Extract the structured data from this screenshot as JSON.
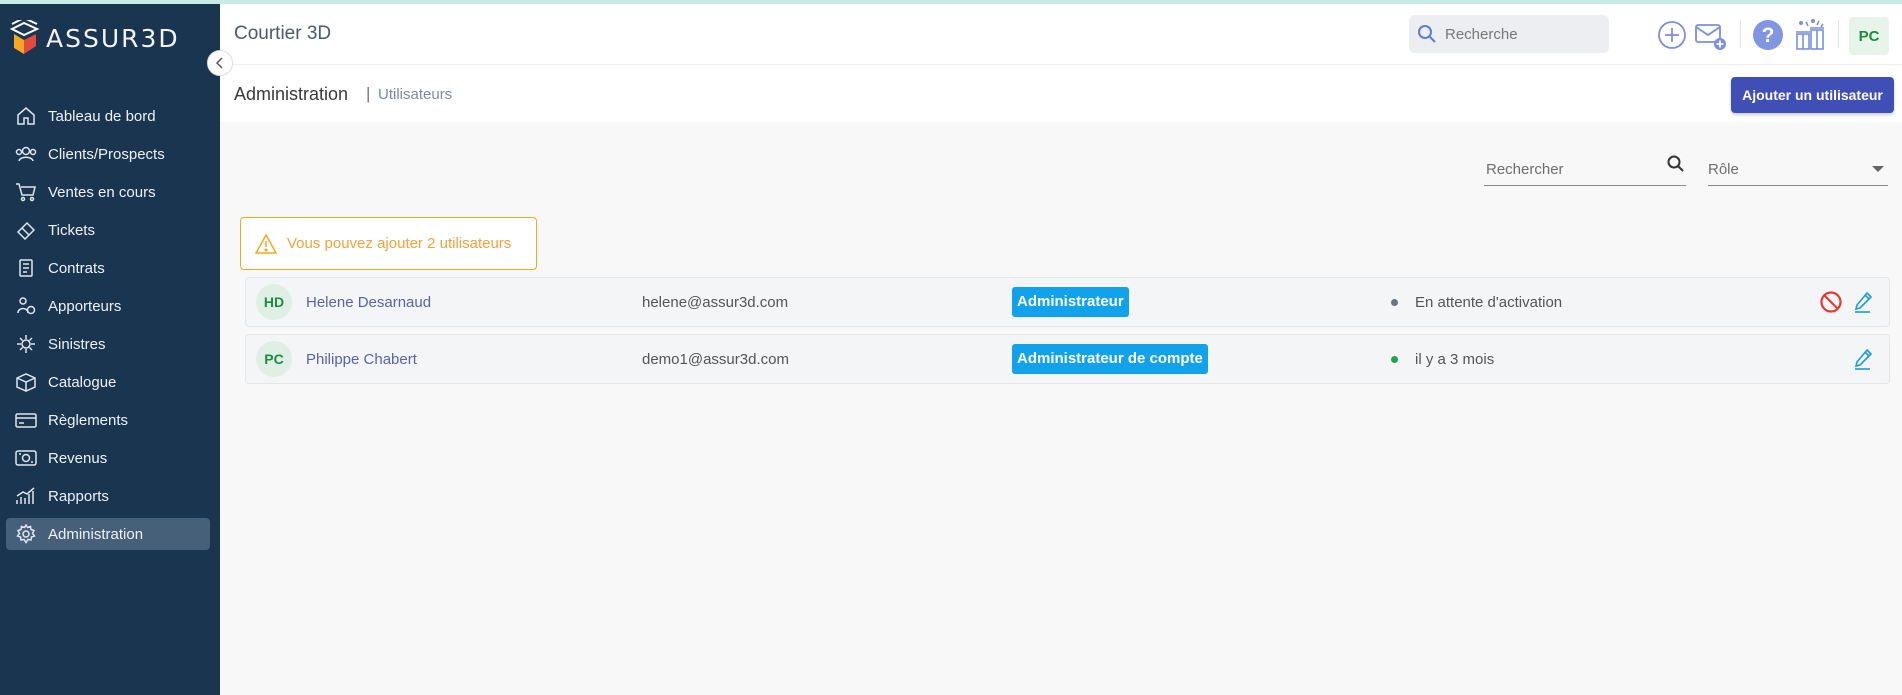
{
  "brand": {
    "logo_text": "ASSUR3D"
  },
  "sidebar": {
    "items": [
      {
        "label": "Tableau de bord",
        "icon": "home-icon"
      },
      {
        "label": "Clients/Prospects",
        "icon": "users-icon"
      },
      {
        "label": "Ventes en cours",
        "icon": "cart-icon"
      },
      {
        "label": "Tickets",
        "icon": "ticket-icon"
      },
      {
        "label": "Contrats",
        "icon": "contract-icon"
      },
      {
        "label": "Apporteurs",
        "icon": "partner-icon"
      },
      {
        "label": "Sinistres",
        "icon": "claims-icon"
      },
      {
        "label": "Catalogue",
        "icon": "catalog-icon"
      },
      {
        "label": "Règlements",
        "icon": "payment-card-icon"
      },
      {
        "label": "Revenus",
        "icon": "revenue-icon"
      },
      {
        "label": "Rapports",
        "icon": "report-chart-icon"
      },
      {
        "label": "Administration",
        "icon": "gear-icon",
        "active": true
      }
    ]
  },
  "topbar": {
    "title": "Courtier 3D",
    "search_placeholder": "Recherche",
    "user_initials": "PC"
  },
  "header": {
    "breadcrumb_main": "Administration",
    "breadcrumb_separator": "|",
    "breadcrumb_sub": "Utilisateurs",
    "add_button": "Ajouter un utilisateur"
  },
  "filters": {
    "search_placeholder": "Rechercher",
    "role_placeholder": "Rôle"
  },
  "warning": {
    "text": "Vous pouvez ajouter 2 utilisateurs"
  },
  "users": [
    {
      "initials": "HD",
      "name": "Helene Desarnaud",
      "email": "helene@assur3d.com",
      "role": "Administrateur",
      "status": "En attente d'activation",
      "status_color": "#6b7480",
      "can_block": true
    },
    {
      "initials": "PC",
      "name": "Philippe Chabert",
      "email": "demo1@assur3d.com",
      "role": "Administrateur de compte",
      "status": "il y a 3 mois",
      "status_color": "#22a34a",
      "can_block": false
    }
  ],
  "colors": {
    "sidebar_bg": "#1a3550",
    "primary_button": "#3f4fb5",
    "role_badge": "#12a2ec",
    "warning": "#f5a623",
    "avatar_green": "#1e8c3e"
  }
}
